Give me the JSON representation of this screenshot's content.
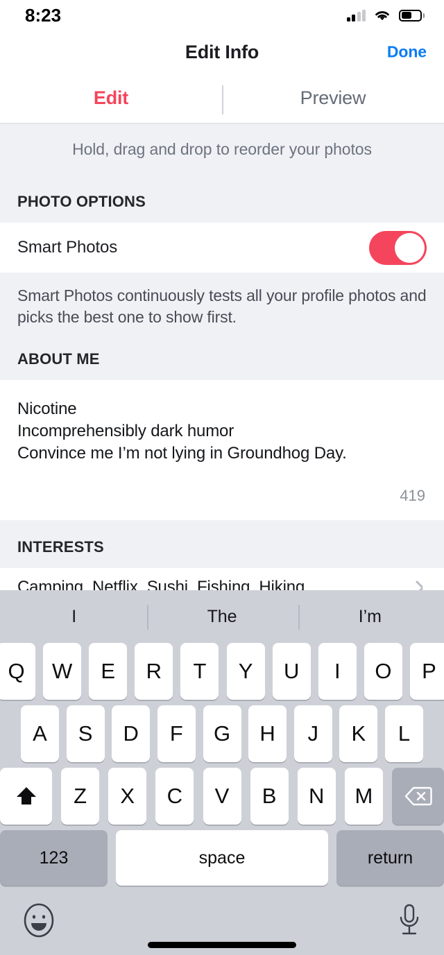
{
  "status_bar": {
    "time": "8:23",
    "cellular_icon": "cellular-signal-icon",
    "cellular_bars_filled": 2,
    "cellular_bars_total": 4,
    "wifi_icon": "wifi-icon",
    "battery_icon": "battery-icon",
    "battery_level_percent": 55
  },
  "nav": {
    "title": "Edit Info",
    "done_label": "Done",
    "done_color": "#0a7cf5"
  },
  "tabs": [
    {
      "label": "Edit",
      "active": true,
      "color": "#f4455c"
    },
    {
      "label": "Preview",
      "active": false,
      "color": "#646c77"
    }
  ],
  "hint": {
    "text": "Hold, drag and drop to reorder your photos"
  },
  "photo_options": {
    "header": "PHOTO OPTIONS",
    "row_label": "Smart Photos",
    "toggle_on": true,
    "toggle_color": "#f4455c",
    "footnote": "Smart Photos continuously tests all your profile photos and picks the best one to show first."
  },
  "about_me": {
    "header": "ABOUT ME",
    "text": "Nicotine\nIncomprehensibly dark humor\nConvince me I’m not lying in Groundhog Day.",
    "char_count": "419"
  },
  "interests": {
    "header": "INTERESTS",
    "value": "Camping, Netflix, Sushi, Fishing, Hiking",
    "chevron_icon": "chevron-right-icon"
  },
  "keyboard": {
    "suggestions": [
      "I",
      "The",
      "I’m"
    ],
    "row1": [
      "Q",
      "W",
      "E",
      "R",
      "T",
      "Y",
      "U",
      "I",
      "O",
      "P"
    ],
    "row2": [
      "A",
      "S",
      "D",
      "F",
      "G",
      "H",
      "J",
      "K",
      "L"
    ],
    "row3": [
      "Z",
      "X",
      "C",
      "V",
      "B",
      "N",
      "M"
    ],
    "shift_icon": "shift-arrow-icon",
    "backspace_icon": "backspace-delete-icon",
    "numbers_label": "123",
    "space_label": "space",
    "return_label": "return",
    "emoji_icon": "emoji-smiley-icon",
    "mic_icon": "microphone-icon"
  }
}
